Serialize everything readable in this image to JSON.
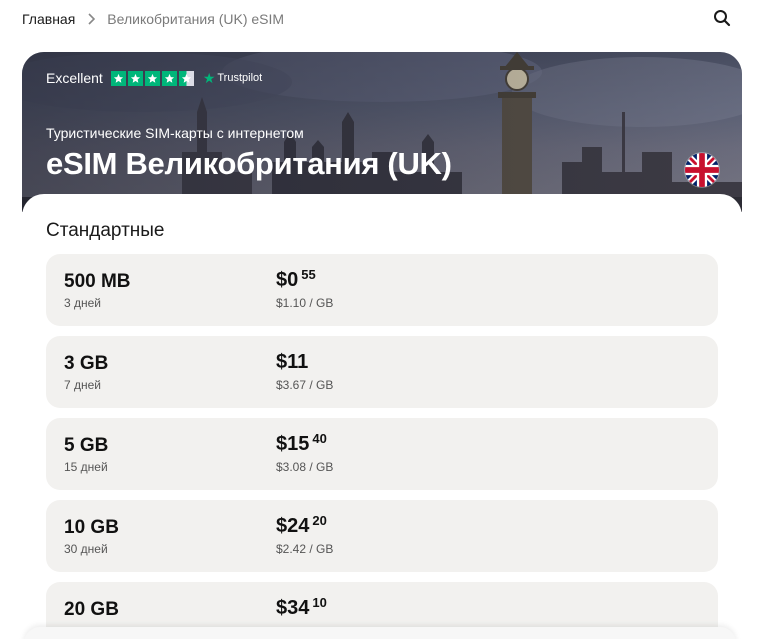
{
  "breadcrumb": {
    "home": "Главная",
    "current": "Великобритания (UK) eSIM"
  },
  "hero": {
    "rating_label": "Excellent",
    "rating_stars": 4.5,
    "rating_brand": "Trustpilot",
    "subtitle": "Туристические SIM-карты с интернетом",
    "title": "eSIM Великобритания (UK)"
  },
  "section": {
    "title": "Стандартные"
  },
  "plans": [
    {
      "size": "500 MB",
      "days": "3 дней",
      "price": "$0",
      "cents": "55",
      "per_gb": "$1.10 / GB"
    },
    {
      "size": "3 GB",
      "days": "7 дней",
      "price": "$11",
      "cents": "",
      "per_gb": "$3.67 / GB"
    },
    {
      "size": "5 GB",
      "days": "15 дней",
      "price": "$15",
      "cents": "40",
      "per_gb": "$3.08 / GB"
    },
    {
      "size": "10 GB",
      "days": "30 дней",
      "price": "$24",
      "cents": "20",
      "per_gb": "$2.42 / GB"
    },
    {
      "size": "20 GB",
      "days": "",
      "price": "$34",
      "cents": "10",
      "per_gb": ""
    }
  ],
  "icons": {
    "search": "search-icon",
    "breadcrumb_separator": "chevron-right-icon",
    "flag": "uk-flag-icon",
    "trustpilot": "trustpilot-star-icon"
  },
  "colors": {
    "trustpilot_green": "#00b67a",
    "card_bg": "#f2f1ef",
    "text_primary": "#111111",
    "text_muted": "#555555"
  }
}
